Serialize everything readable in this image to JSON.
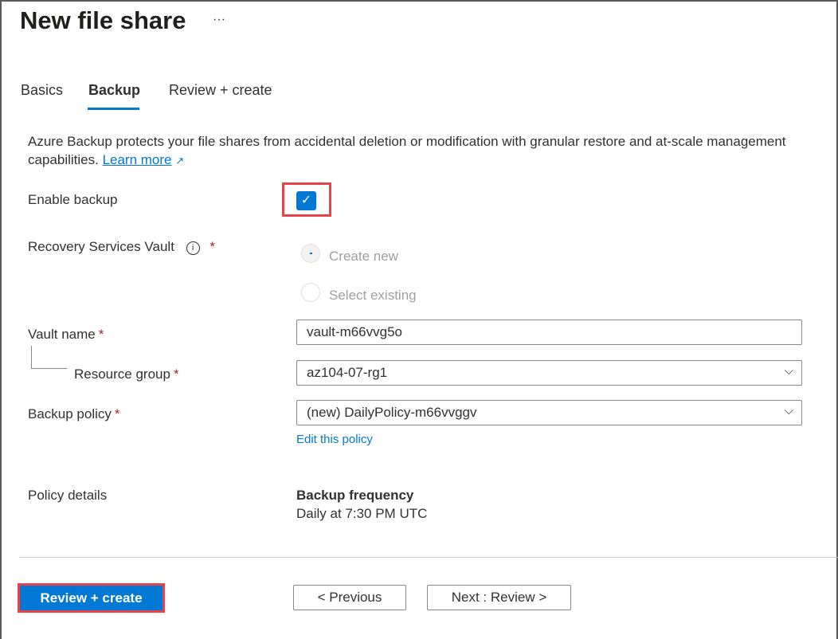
{
  "header": {
    "title": "New file share",
    "more": "···"
  },
  "tabs": [
    {
      "label": "Basics"
    },
    {
      "label": "Backup"
    },
    {
      "label": "Review + create"
    }
  ],
  "description": {
    "text": "Azure Backup protects your file shares from accidental deletion or modification with granular restore and at-scale management capabilities.",
    "link": "Learn more",
    "link_icon": "↗"
  },
  "form": {
    "enable_backup": {
      "label": "Enable backup",
      "checked": true,
      "check": "✓"
    },
    "vault": {
      "label": "Recovery Services Vault",
      "info": "i",
      "required": "*",
      "options": [
        {
          "label": "Create new",
          "selected": true
        },
        {
          "label": "Select existing",
          "selected": false
        }
      ]
    },
    "vault_name": {
      "label": "Vault name",
      "required": "*",
      "value": "vault-m66vvg5o"
    },
    "resource_group": {
      "label": "Resource group",
      "required": "*",
      "value": "az104-07-rg1"
    },
    "backup_policy": {
      "label": "Backup policy",
      "required": "*",
      "value": "(new) DailyPolicy-m66vvggv",
      "edit_link": "Edit this policy"
    },
    "policy_details": {
      "label": "Policy details",
      "heading": "Backup frequency",
      "value": "Daily at 7:30 PM UTC"
    }
  },
  "footer": {
    "review_create": "Review + create",
    "previous": "< Previous",
    "next": "Next : Review >"
  }
}
